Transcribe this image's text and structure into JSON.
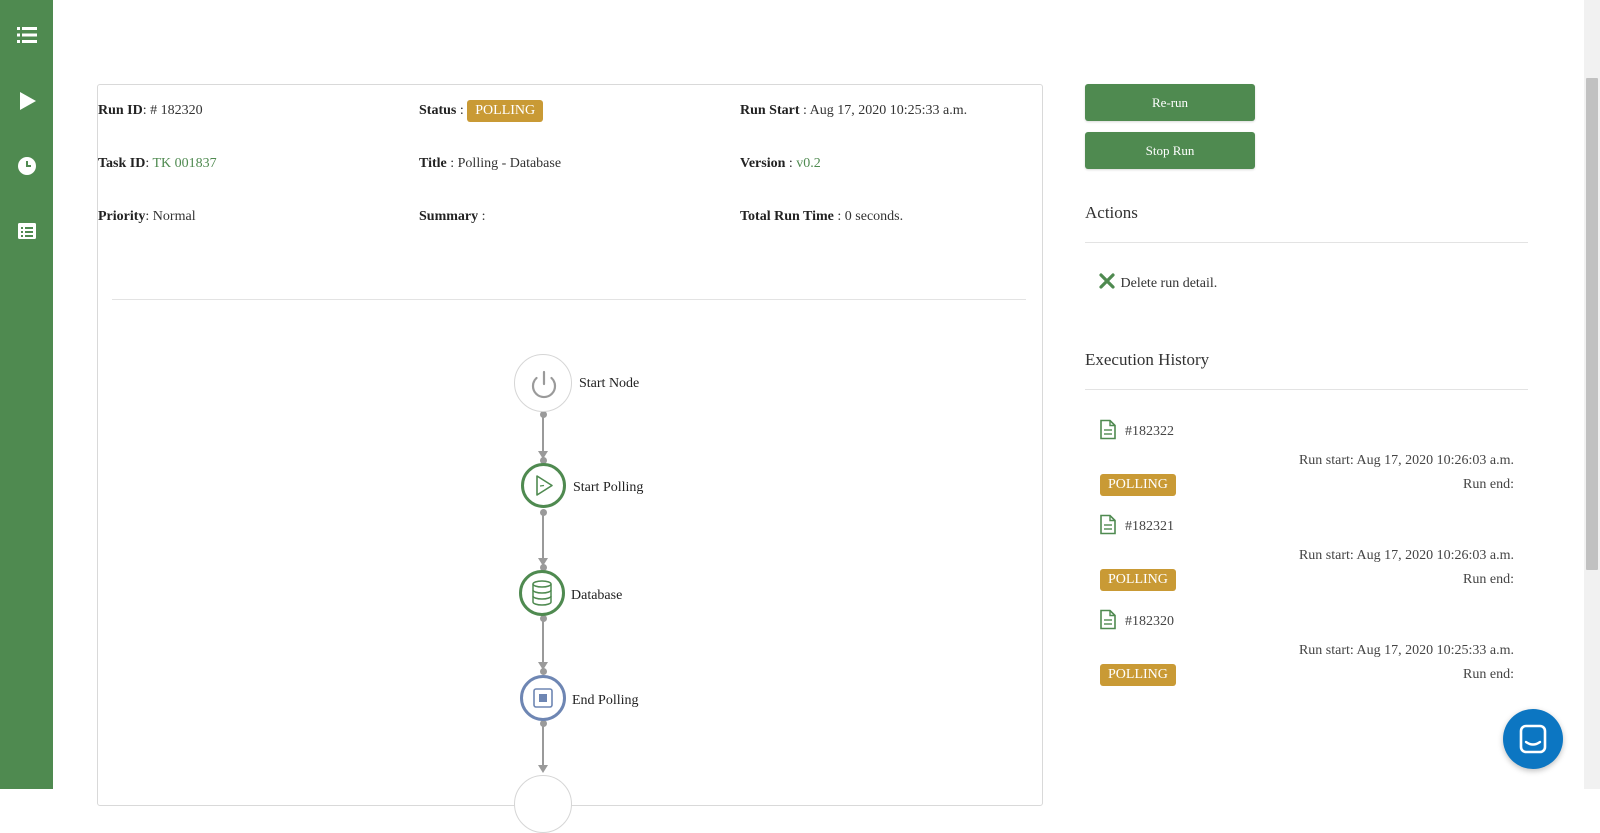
{
  "sidebar": {
    "icons": [
      "list-icon",
      "play-icon",
      "clock-icon",
      "detail-list-icon"
    ]
  },
  "run": {
    "run_id_label": "Run ID",
    "run_id_value": ": # 182320",
    "status_label": "Status",
    "status_sep": " : ",
    "status_value": "POLLING",
    "run_start_label": "Run Start",
    "run_start_value": " : Aug 17, 2020 10:25:33 a.m.",
    "task_id_label": "Task ID",
    "task_id_sep": ": ",
    "task_id_value": "TK 001837",
    "title_label": "Title",
    "title_value": " : Polling - Database",
    "version_label": "Version",
    "version_sep": " : ",
    "version_value": "v0.2",
    "priority_label": "Priority",
    "priority_value": ": Normal",
    "summary_label": "Summary",
    "summary_value": " :",
    "total_label": "Total Run Time",
    "total_value": " : 0 seconds."
  },
  "flow": {
    "nodes": [
      {
        "label": "Start Node",
        "icon": "power-icon"
      },
      {
        "label": "Start Polling",
        "icon": "play-outline-icon"
      },
      {
        "label": "Database",
        "icon": "database-icon"
      },
      {
        "label": "End Polling",
        "icon": "stop-icon"
      }
    ]
  },
  "actions": {
    "rerun_label": "Re-run",
    "stop_label": "Stop Run",
    "title": "Actions",
    "delete_label": "Delete run detail."
  },
  "history": {
    "title": "Execution History",
    "items": [
      {
        "id": "#182322",
        "start": "Run start: Aug 17, 2020 10:26:03 a.m.",
        "end": "Run end:",
        "status": "POLLING"
      },
      {
        "id": "#182321",
        "start": "Run start: Aug 17, 2020 10:26:03 a.m.",
        "end": "Run end:",
        "status": "POLLING"
      },
      {
        "id": "#182320",
        "start": "Run start: Aug 17, 2020 10:25:33 a.m.",
        "end": "Run end:",
        "status": "POLLING"
      }
    ]
  },
  "colors": {
    "primary": "#4f8a50",
    "status_badge": "#c99a35",
    "end_node": "#6e86b3",
    "chat": "#0c76c2"
  }
}
